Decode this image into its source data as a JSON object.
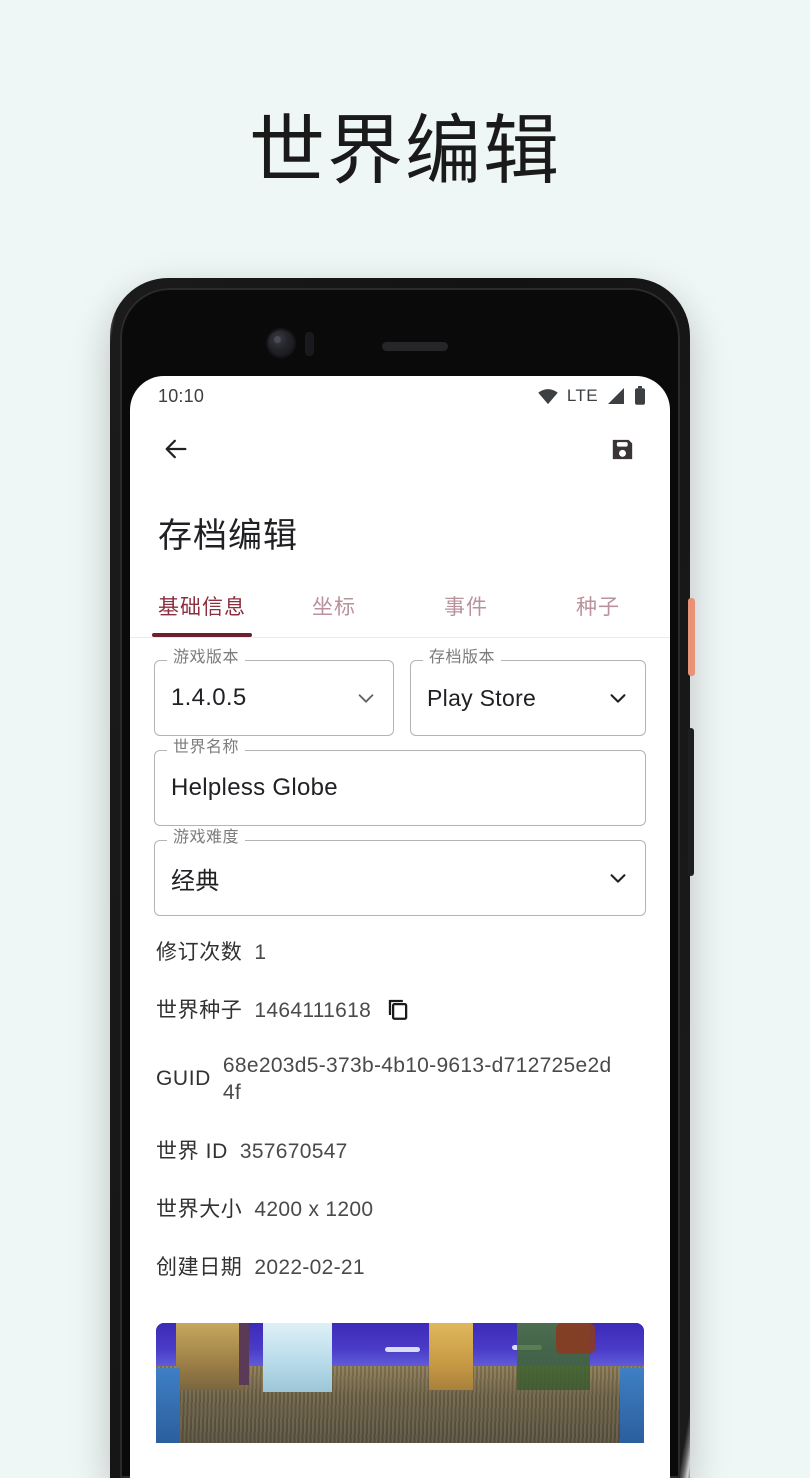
{
  "promo": {
    "headline": "世界编辑",
    "background_color": "#eff7f6"
  },
  "device": {
    "power_button_color": "#e99275",
    "volume_button_color": "#1e1e1e"
  },
  "status_bar": {
    "time": "10:10",
    "network_label": "LTE",
    "icons": [
      "wifi-icon",
      "signal-icon",
      "battery-icon"
    ]
  },
  "app_bar": {
    "back_icon": "back-arrow-icon",
    "save_icon": "save-floppy-icon"
  },
  "page": {
    "title": "存档编辑"
  },
  "tabs": {
    "active_index": 0,
    "active_color": "#8c2f3e",
    "inactive_color": "#b9929b",
    "indicator_color": "#6e1f2e",
    "items": [
      {
        "label": "基础信息"
      },
      {
        "label": "坐标"
      },
      {
        "label": "事件"
      },
      {
        "label": "种子"
      }
    ]
  },
  "form": {
    "game_version": {
      "label": "游戏版本",
      "value": "1.4.0.5"
    },
    "save_version": {
      "label": "存档版本",
      "value": "Play Store"
    },
    "world_name": {
      "label": "世界名称",
      "value": "Helpless Globe"
    },
    "difficulty": {
      "label": "游戏难度",
      "value": "经典"
    }
  },
  "info": {
    "rows": [
      {
        "label": "修订次数",
        "value": "1",
        "copy": false
      },
      {
        "label": "世界种子",
        "value": "1464111618",
        "copy": true
      },
      {
        "label": "GUID",
        "value": "68e203d5-373b-4b10-9613-d712725e2d4f",
        "copy": false
      },
      {
        "label": "世界 ID",
        "value": "357670547",
        "copy": false
      },
      {
        "label": "世界大小",
        "value": "4200 x 1200",
        "copy": false
      },
      {
        "label": "创建日期",
        "value": "2022-02-21",
        "copy": false
      }
    ]
  },
  "map_preview": {
    "alt": "terraria-world-map-preview"
  }
}
